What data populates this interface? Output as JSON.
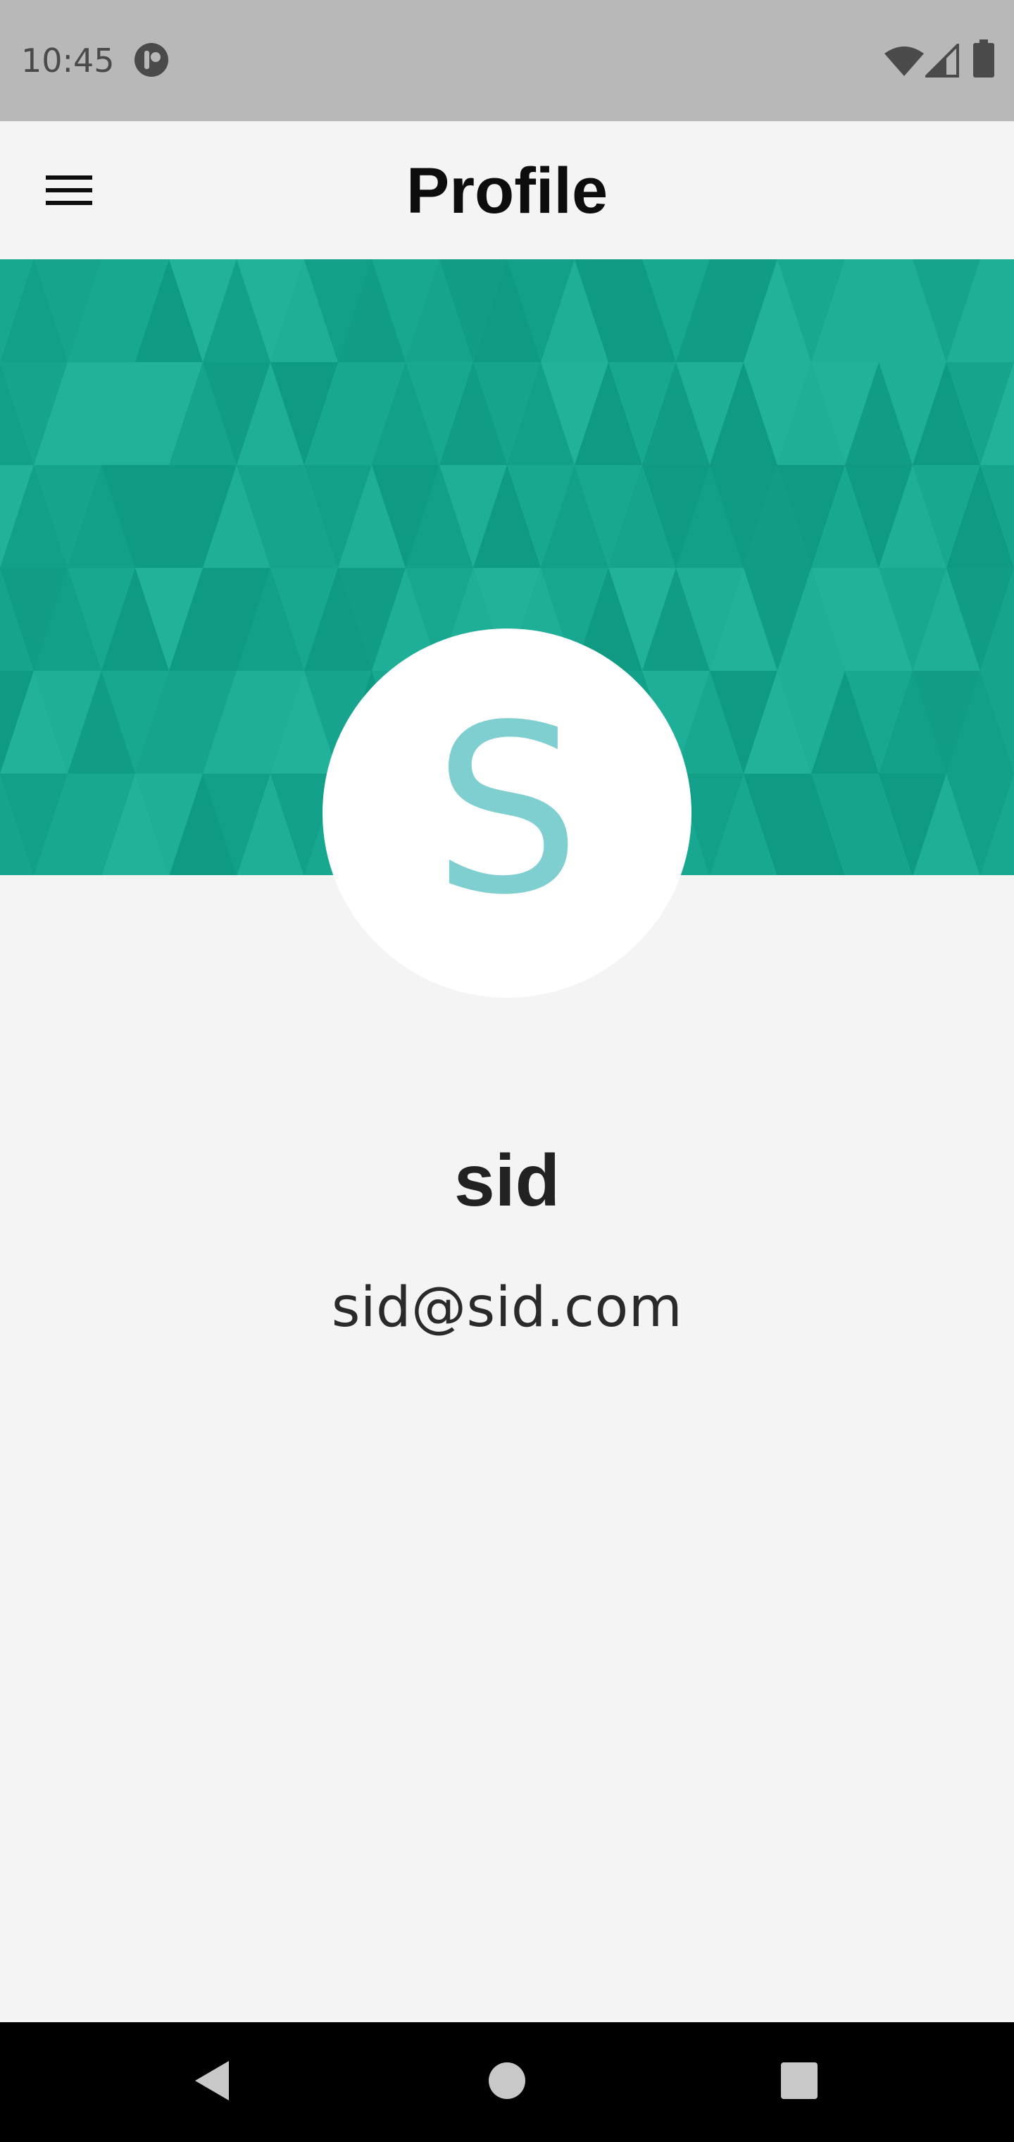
{
  "status_bar": {
    "time": "10:45",
    "icons": [
      "app-notification-icon",
      "wifi-icon",
      "cell-signal-icon",
      "battery-icon"
    ]
  },
  "app_bar": {
    "title": "Profile",
    "menu_icon": "hamburger-menu-icon"
  },
  "banner": {
    "color": "#14a18b"
  },
  "profile": {
    "avatar_initial": "S",
    "avatar_initial_color": "#7fcfd0",
    "name": "sid",
    "email": "sid@sid.com"
  },
  "navigation_bar": {
    "buttons": [
      "back-icon",
      "home-icon",
      "recents-icon"
    ]
  }
}
